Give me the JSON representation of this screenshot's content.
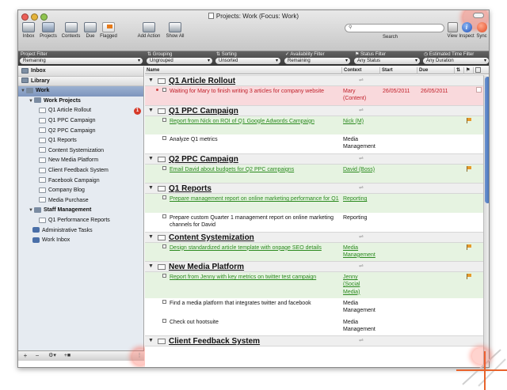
{
  "window": {
    "title": "Projects: Work (Focus: Work)"
  },
  "toolbar": {
    "inbox": "Inbox",
    "projects": "Projects",
    "contexts": "Contexts",
    "due": "Due",
    "flagged": "Flagged",
    "add_action": "Add Action",
    "show_all": "Show All",
    "search_placeholder": "",
    "search_label": "Search",
    "view": "View",
    "inspect": "Inspect",
    "sync": "Sync"
  },
  "filters": [
    {
      "caption": "Project Filter",
      "value": "Remaining"
    },
    {
      "caption": "Grouping",
      "value": "Ungrouped"
    },
    {
      "caption": "Sorting",
      "value": "Unsorted"
    },
    {
      "caption": "Availability Filter",
      "value": "Remaining"
    },
    {
      "caption": "Status Filter",
      "value": "Any Status"
    },
    {
      "caption": "Estimated Time Filter",
      "value": "Any Duration"
    }
  ],
  "sidebar": {
    "items": [
      {
        "label": "Inbox"
      },
      {
        "label": "Library"
      },
      {
        "label": "Work"
      },
      {
        "label": "Work Projects"
      },
      {
        "label": "Q1 Article Rollout",
        "badge": "1"
      },
      {
        "label": "Q1 PPC Campaign"
      },
      {
        "label": "Q2 PPC Campaign"
      },
      {
        "label": "Q1 Reports"
      },
      {
        "label": "Content Systemization"
      },
      {
        "label": "New Media Platform"
      },
      {
        "label": "Client Feedback System"
      },
      {
        "label": "Facebook Campaign"
      },
      {
        "label": "Company Blog"
      },
      {
        "label": "Media Purchase"
      },
      {
        "label": "Staff Management"
      },
      {
        "label": "Q1 Performance Reports"
      },
      {
        "label": "Administrative Tasks"
      },
      {
        "label": "Work Inbox"
      }
    ],
    "bottom_buttons": [
      "+",
      "−",
      "⚙▾",
      "+■"
    ]
  },
  "columns": {
    "name": "Name",
    "context": "Context",
    "start": "Start",
    "due": "Due"
  },
  "projects": [
    {
      "title": "Q1 Article Rollout",
      "actions": [
        {
          "name": "Waiting for Mary to finish writing 3 articles for company website",
          "context": "Mary (Content)",
          "start": "26/05/2011",
          "due": "26/05/2011",
          "style": "red"
        }
      ]
    },
    {
      "title": "Q1 PPC Campaign",
      "actions": [
        {
          "name": "Report from Nick on ROI of Q1 Google Adwords Campaign",
          "context": "Nick (M)",
          "start": "",
          "due": "",
          "style": "green"
        },
        {
          "name": "Analyze Q1 metrics",
          "context": "Media Management",
          "start": "",
          "due": "",
          "style": ""
        }
      ]
    },
    {
      "title": "Q2 PPC Campaign",
      "actions": [
        {
          "name": "Email David about budgets for Q2 PPC campaigns",
          "context": "David (Boss)",
          "start": "",
          "due": "",
          "style": "green"
        }
      ]
    },
    {
      "title": "Q1 Reports",
      "actions": [
        {
          "name": "Prepare management report on online marketing performance for Q1",
          "context": "Reporting",
          "start": "",
          "due": "",
          "style": "green"
        },
        {
          "name": "Prepare custom Quarter 1 management report on online marketing channels for David",
          "context": "Reporting",
          "start": "",
          "due": "",
          "style": ""
        }
      ]
    },
    {
      "title": "Content Systemization",
      "actions": [
        {
          "name": "Design standardized article template with onpage SEO details",
          "context": "Media Management",
          "start": "",
          "due": "",
          "style": "green"
        }
      ]
    },
    {
      "title": "New Media Platform",
      "actions": [
        {
          "name": "Report from Jenny with key metrics on twitter test campaign",
          "context": "Jenny (Social Media)",
          "start": "",
          "due": "",
          "style": "green"
        },
        {
          "name": "Find a media platform that integrates twitter and facebook",
          "context": "Media Management",
          "start": "",
          "due": "",
          "style": ""
        },
        {
          "name": "Check out hootsuite",
          "context": "Media Management",
          "start": "",
          "due": "",
          "style": ""
        }
      ]
    },
    {
      "title": "Client Feedback System",
      "actions": []
    }
  ],
  "colors": {
    "accent": "#7d95bd",
    "overdue": "#c0202a",
    "available": "#2b8a1f",
    "flag": "#e69a2a"
  }
}
